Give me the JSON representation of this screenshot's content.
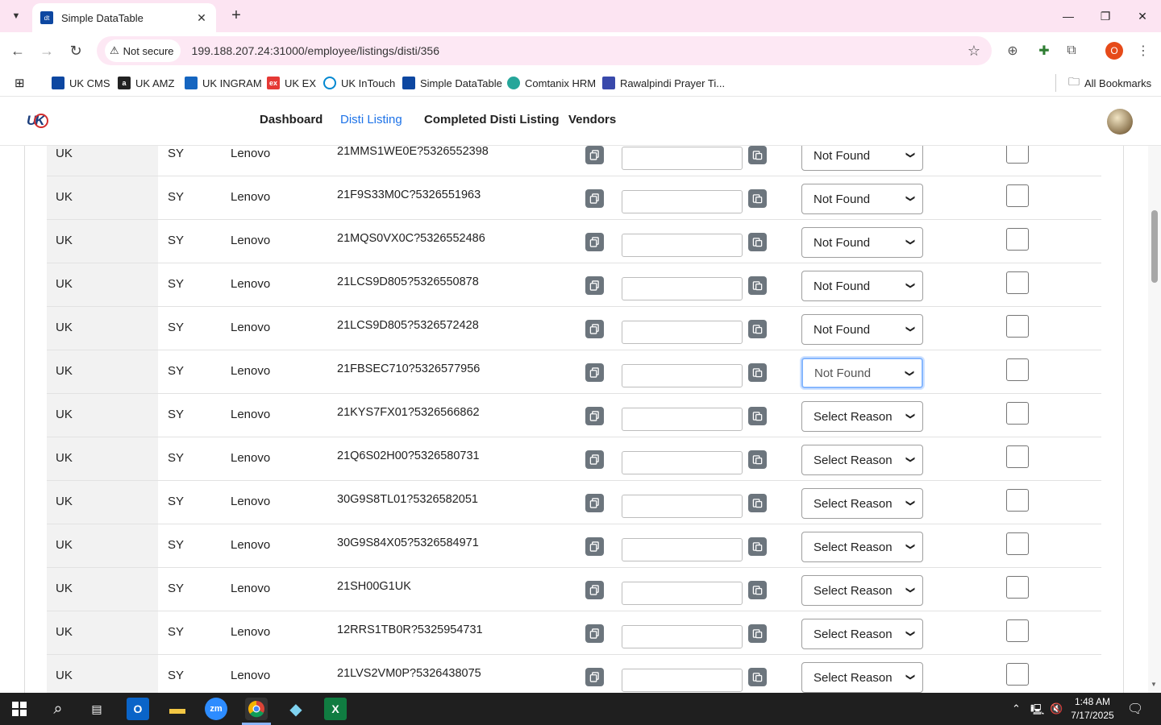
{
  "browser": {
    "tab_title": "Simple DataTable",
    "security_label": "Not secure",
    "url": "199.188.207.24:31000/employee/listings/disti/356",
    "profile_initial": "O",
    "bookmarks": [
      {
        "label": "UK CMS",
        "color": "#0d47a1"
      },
      {
        "label": "UK AMZ",
        "color": "#222222"
      },
      {
        "label": "UK INGRAM",
        "color": "#1565c0"
      },
      {
        "label": "UK EX",
        "color": "#e53935"
      },
      {
        "label": "UK InTouch",
        "color": "#0288d1"
      },
      {
        "label": "Simple DataTable",
        "color": "#0d47a1"
      },
      {
        "label": "Comtanix HRM",
        "color": "#26a69a"
      },
      {
        "label": "Rawalpindi Prayer Ti...",
        "color": "#3949ab"
      }
    ],
    "all_bookmarks": "All Bookmarks"
  },
  "app": {
    "nav": [
      {
        "label": "Dashboard",
        "active": false
      },
      {
        "label": "Disti Listing",
        "active": true
      },
      {
        "label": "Completed Disti Listing",
        "active": false
      },
      {
        "label": "Vendors",
        "active": false
      }
    ]
  },
  "table": {
    "rows": [
      {
        "region": "UK",
        "code": "SY",
        "brand": "Lenovo",
        "sku": "21MMS1WE0E?5326552398",
        "input": "",
        "reason": "Not Found"
      },
      {
        "region": "UK",
        "code": "SY",
        "brand": "Lenovo",
        "sku": "21F9S33M0C?5326551963",
        "input": "",
        "reason": "Not Found"
      },
      {
        "region": "UK",
        "code": "SY",
        "brand": "Lenovo",
        "sku": "21MQS0VX0C?5326552486",
        "input": "",
        "reason": "Not Found"
      },
      {
        "region": "UK",
        "code": "SY",
        "brand": "Lenovo",
        "sku": "21LCS9D805?5326550878",
        "input": "",
        "reason": "Not Found"
      },
      {
        "region": "UK",
        "code": "SY",
        "brand": "Lenovo",
        "sku": "21LCS9D805?5326572428",
        "input": "",
        "reason": "Not Found"
      },
      {
        "region": "UK",
        "code": "SY",
        "brand": "Lenovo",
        "sku": "21FBSEC710?5326577956",
        "input": "",
        "reason": "Not Found",
        "focused": true
      },
      {
        "region": "UK",
        "code": "SY",
        "brand": "Lenovo",
        "sku": "21KYS7FX01?5326566862",
        "input": "",
        "reason": "Select Reason"
      },
      {
        "region": "UK",
        "code": "SY",
        "brand": "Lenovo",
        "sku": "21Q6S02H00?5326580731",
        "input": "",
        "reason": "Select Reason"
      },
      {
        "region": "UK",
        "code": "SY",
        "brand": "Lenovo",
        "sku": "30G9S8TL01?5326582051",
        "input": "",
        "reason": "Select Reason"
      },
      {
        "region": "UK",
        "code": "SY",
        "brand": "Lenovo",
        "sku": "30G9S84X05?5326584971",
        "input": "",
        "reason": "Select Reason"
      },
      {
        "region": "UK",
        "code": "SY",
        "brand": "Lenovo",
        "sku": "21SH00G1UK",
        "input": "",
        "reason": "Select Reason"
      },
      {
        "region": "UK",
        "code": "SY",
        "brand": "Lenovo",
        "sku": "12RRS1TB0R?5325954731",
        "input": "",
        "reason": "Select Reason"
      },
      {
        "region": "UK",
        "code": "SY",
        "brand": "Lenovo",
        "sku": "21LVS2VM0P?5326438075",
        "input": "",
        "reason": "Select Reason"
      }
    ]
  },
  "taskbar": {
    "time": "1:48 AM",
    "date": "7/17/2025"
  }
}
